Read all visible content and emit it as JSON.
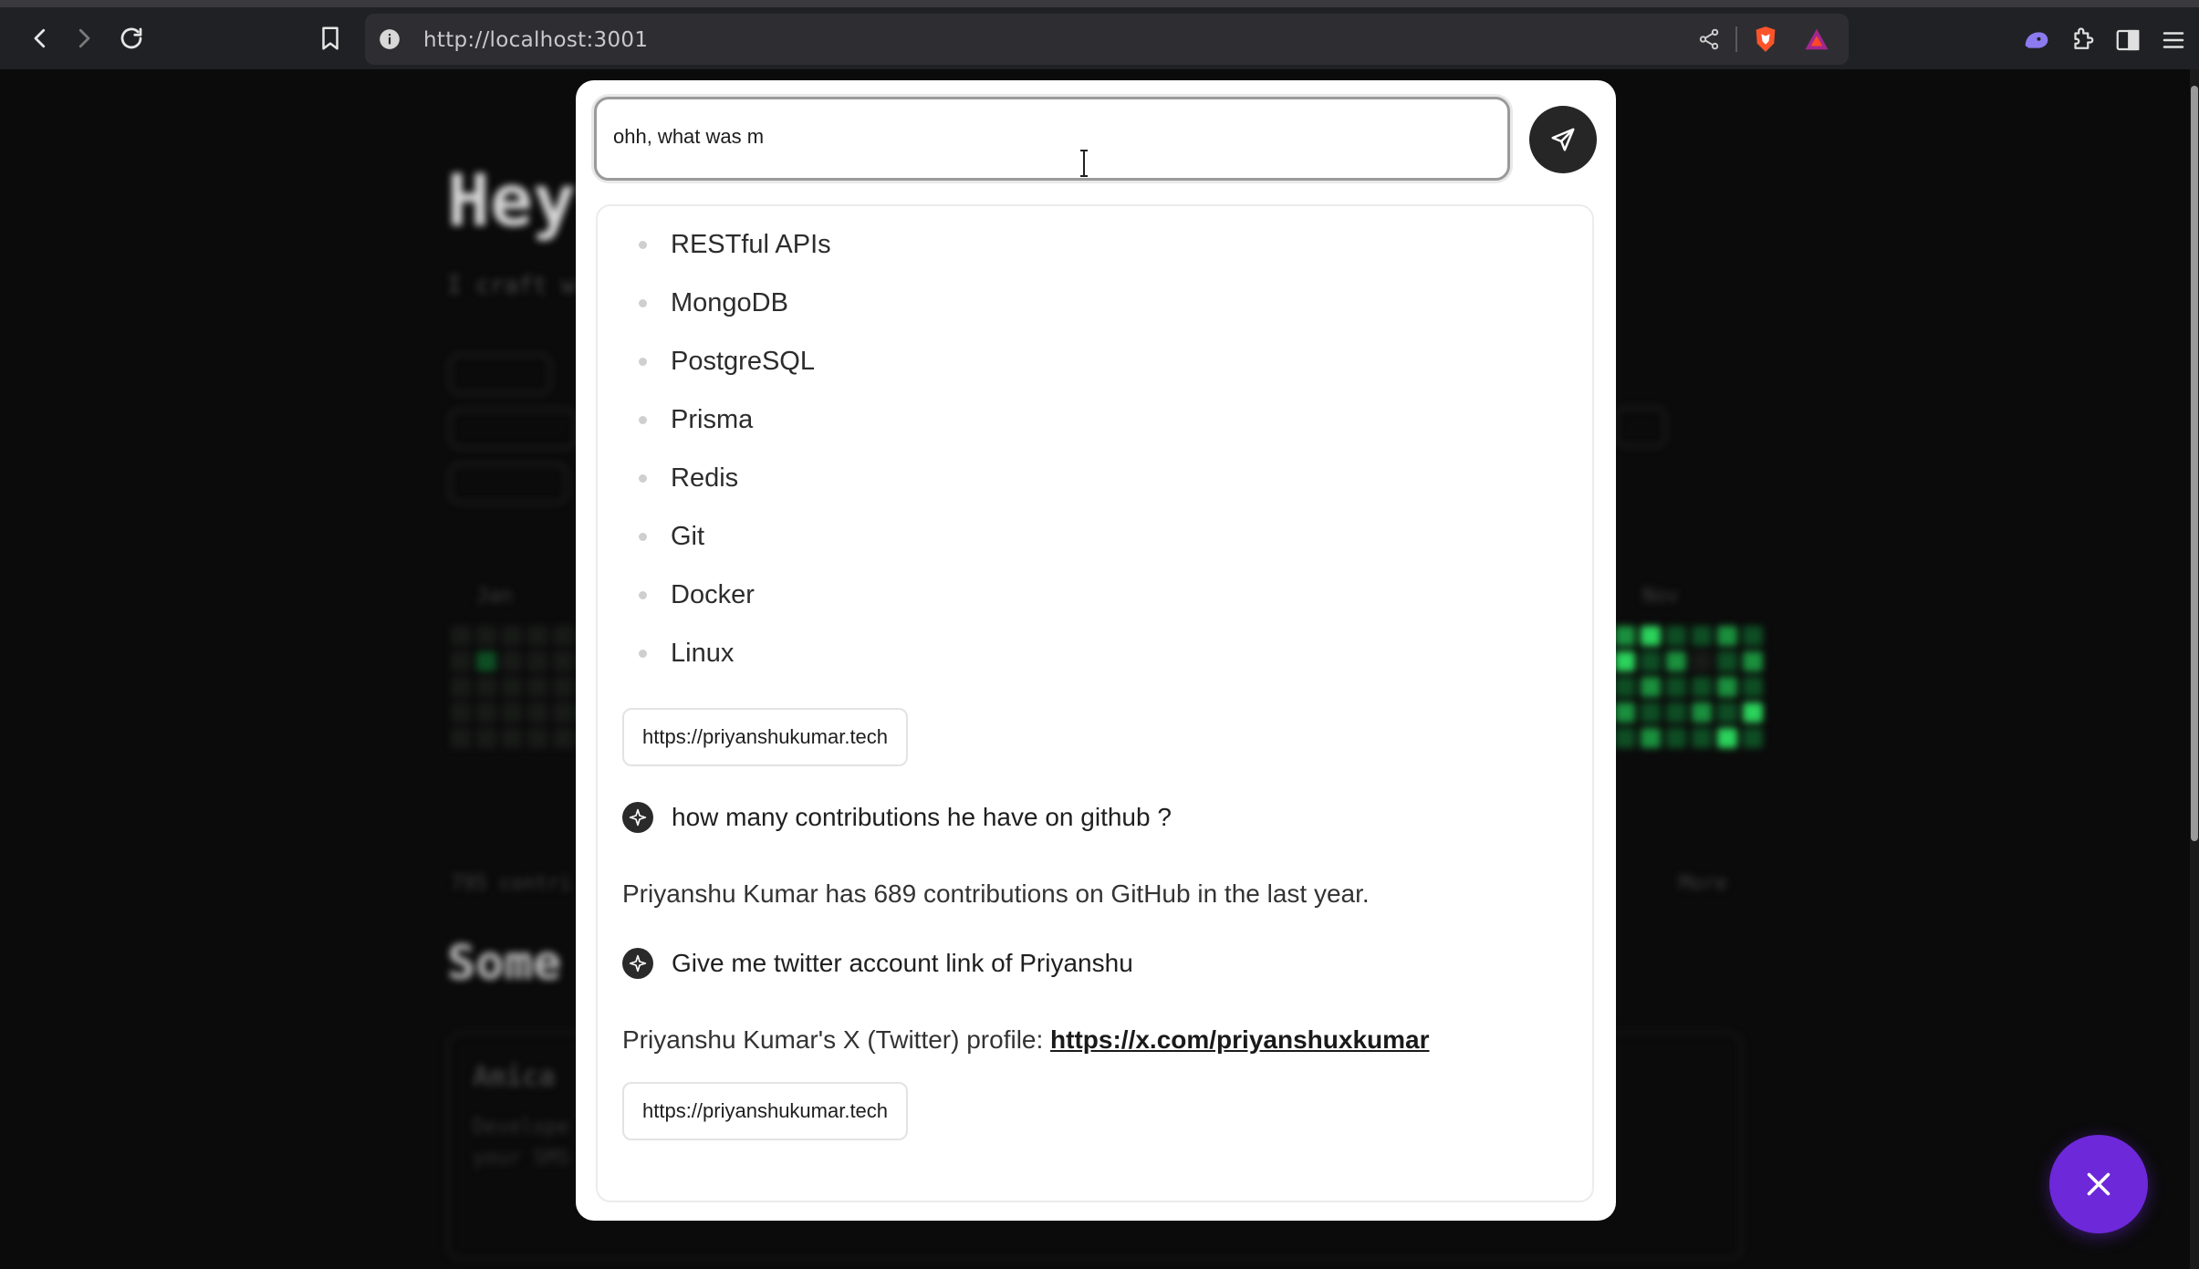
{
  "browser": {
    "url": "http://localhost:3001"
  },
  "background_page": {
    "title": "Hey",
    "subtitle": "I craft w",
    "section_title": "Some",
    "month_start": "Jan",
    "month_end": "Nov",
    "card_title": "Amica",
    "card_text_line1": "Develope",
    "card_text_line2": "your SMS",
    "more_label": "More",
    "footer_label": "795 contri"
  },
  "chat": {
    "input_value": "ohh, what was m",
    "skills": [
      "RESTful APIs",
      "MongoDB",
      "PostgreSQL",
      "Prisma",
      "Redis",
      "Git",
      "Docker",
      "Linux"
    ],
    "link_chip_1": "https://priyanshukumar.tech",
    "question_1": "how many contributions he have on github ?",
    "answer_1": "Priyanshu Kumar has 689 contributions on GitHub in the last year.",
    "question_2": "Give me twitter account link of Priyanshu",
    "answer_2_prefix": "Priyanshu Kumar's X (Twitter) profile: ",
    "answer_2_link": "https://x.com/priyanshuxkumar",
    "link_chip_2": "https://priyanshukumar.tech"
  },
  "colors": {
    "accent": "#6d28d9",
    "send_button": "#262626",
    "panel_background": "#ffffff",
    "page_background": "#0d0d0d"
  },
  "icons": {
    "back": "arrow-left-icon",
    "forward": "arrow-right-icon",
    "reload": "reload-icon",
    "bookmark": "bookmark-icon",
    "site_info": "info-icon",
    "share": "share-icon",
    "brave_shield": "brave-shield-icon",
    "brave_rewards": "brave-rewards-icon",
    "leo": "leo-icon",
    "extensions": "puzzle-icon",
    "sidebar": "sidebar-icon",
    "menu": "hamburger-icon",
    "send": "send-icon",
    "sparkle": "sparkle-icon",
    "close": "close-icon"
  }
}
